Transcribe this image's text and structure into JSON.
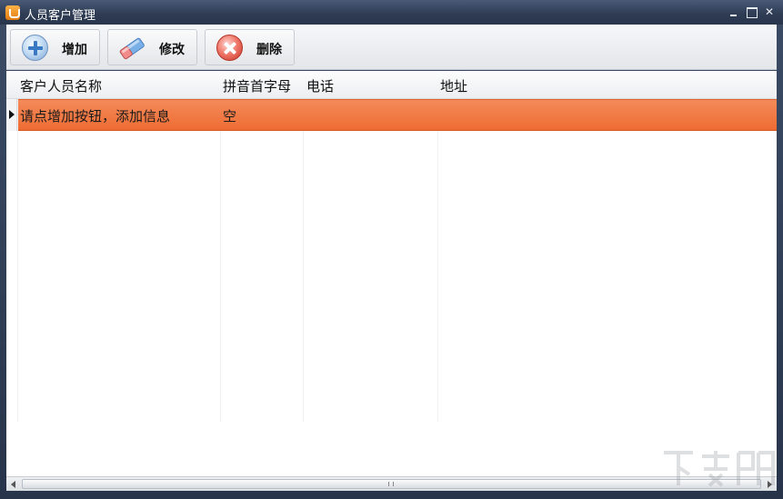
{
  "window": {
    "title": "人员客户管理",
    "app_icon": "download-icon"
  },
  "window_controls": {
    "minimize_icon": "minimize-icon",
    "maximize_icon": "maximize-icon",
    "close_icon": "close-icon",
    "close_glyph": "✕"
  },
  "toolbar": {
    "add_label": "增加",
    "edit_label": "修改",
    "delete_label": "删除",
    "add_icon": "plus-circle-icon",
    "edit_icon": "eraser-icon",
    "delete_icon": "x-circle-icon"
  },
  "grid": {
    "columns": [
      "客户人员名称",
      "拼音首字母",
      "电话",
      "地址"
    ],
    "rows": [
      {
        "name": "请点增加按钮，添加信息",
        "pinyin": "空",
        "phone": "",
        "address": ""
      }
    ],
    "selected_row_index": 0
  },
  "colors": {
    "selected_row": "#EE6C33",
    "title_bar": "#2F3D55",
    "toolbar": "#E9EBEE"
  }
}
